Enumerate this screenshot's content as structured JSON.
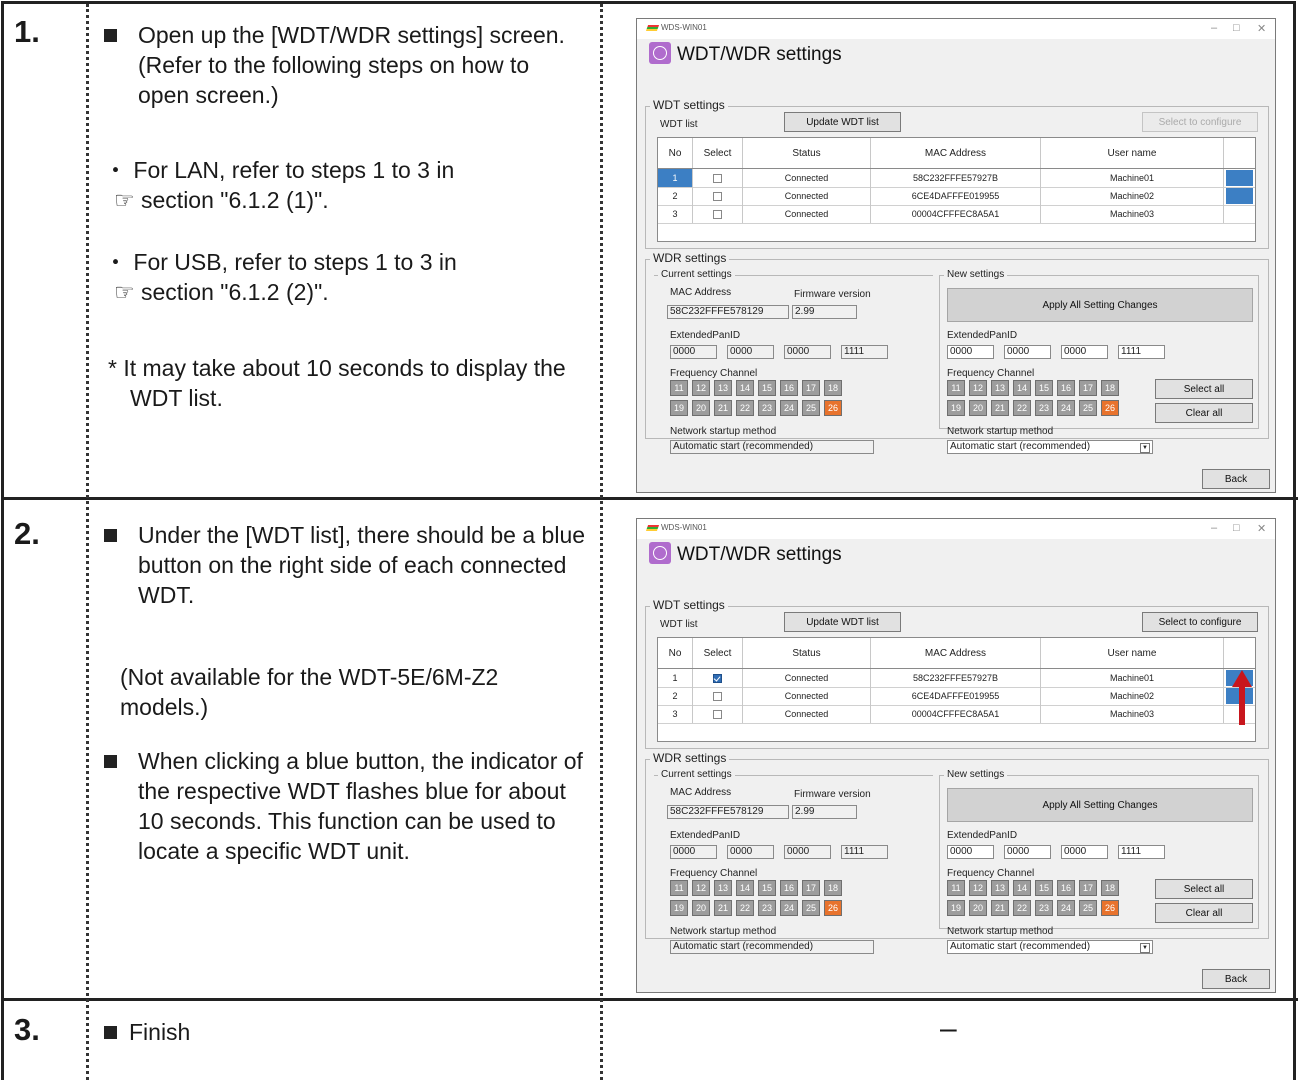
{
  "steps": [
    {
      "number": "1.",
      "paragraphs": [
        "Open up the [WDT/WDR settings] screen. (Refer to the following steps on how to open screen.)",
        "・ For LAN, refer to steps 1 to 3 in",
        "☞ section \"6.1.2 (1)\".",
        "・ For USB, refer to steps 1 to 3 in",
        "☞ section \"6.1.2 (2)\".",
        "* It may take about 10 seconds to display the WDT list."
      ]
    },
    {
      "number": "2.",
      "paragraphs": [
        "Under the [WDT list], there should be a blue button on the right side of each connected WDT.",
        "(Not available for the WDT-5E/6M-Z2 models.)",
        "When clicking a blue button, the indicator of the respective WDT flashes blue for about 10 seconds. This function can be used to locate a specific WDT unit."
      ]
    },
    {
      "number": "3.",
      "paragraphs": [
        "Finish"
      ],
      "right": "–"
    }
  ],
  "window": {
    "app_title": "WDS-WIN01",
    "heading": "WDT/WDR settings",
    "wdt_settings_label": "WDT settings",
    "wdt_list_label": "WDT list",
    "update_button": "Update WDT list",
    "select_configure_button": "Select to configure",
    "columns": [
      "No",
      "Select",
      "Status",
      "MAC Address",
      "User name"
    ],
    "rows": [
      {
        "no": "1",
        "status": "Connected",
        "mac": "58C232FFFE57927B",
        "user": "Machine01"
      },
      {
        "no": "2",
        "status": "Connected",
        "mac": "6CE4DAFFFE019955",
        "user": "Machine02"
      },
      {
        "no": "3",
        "status": "Connected",
        "mac": "00004CFFFEC8A5A1",
        "user": "Machine03"
      }
    ],
    "wdr_settings_label": "WDR settings",
    "current_settings_label": "Current settings",
    "new_settings_label": "New settings",
    "mac_label": "MAC Address",
    "mac_value": "58C232FFFE578129",
    "firmware_label": "Firmware version",
    "firmware_value": "2.99",
    "apply_button": "Apply All Setting Changes",
    "panid_label": "ExtendedPanID",
    "panid_values": [
      "0000",
      "0000",
      "0000",
      "1111"
    ],
    "freq_label": "Frequency Channel",
    "channels": [
      "11",
      "12",
      "13",
      "14",
      "15",
      "16",
      "17",
      "18",
      "19",
      "20",
      "21",
      "22",
      "23",
      "24",
      "25",
      "26"
    ],
    "active_channel": "26",
    "select_all_button": "Select all",
    "clear_all_button": "Clear all",
    "network_label": "Network startup method",
    "network_value": "Automatic start (recommended)",
    "back_button": "Back",
    "colors": {
      "blue_button": "#3c7fc4",
      "active_channel": "#e8732d",
      "arrow": "#c8161d"
    }
  }
}
